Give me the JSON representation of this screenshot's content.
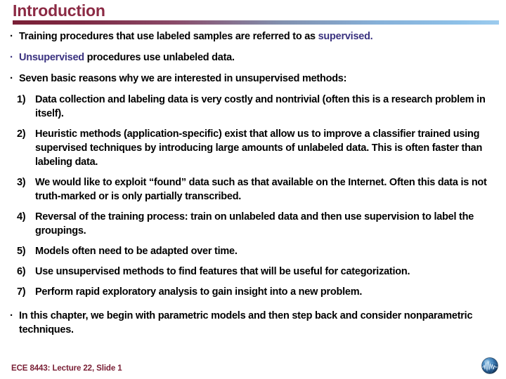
{
  "slide": {
    "title": "Introduction",
    "bullets": [
      {
        "marker": "·",
        "marker_accent": false,
        "segments": [
          {
            "text": "Training procedures that use labeled samples are referred to as ",
            "accent": false
          },
          {
            "text": "supervised.",
            "accent": true
          }
        ]
      },
      {
        "marker": "·",
        "marker_accent": true,
        "segments": [
          {
            "text": "Unsupervised",
            "accent": true
          },
          {
            "text": " procedures use unlabeled data.",
            "accent": false
          }
        ]
      },
      {
        "marker": "·",
        "marker_accent": false,
        "segments": [
          {
            "text": "Seven basic reasons why we are interested in unsupervised methods:",
            "accent": false
          }
        ]
      }
    ],
    "numbered_items": [
      {
        "marker": "1)",
        "text": "Data collection and labeling data is very costly and nontrivial (often this is a research problem in itself)."
      },
      {
        "marker": "2)",
        "text": "Heuristic methods (application-specific) exist that allow us to improve a classifier trained using supervised techniques by introducing large amounts of unlabeled data. This is often faster than labeling data."
      },
      {
        "marker": "3)",
        "text": "We would like to exploit “found” data such as that available on the Internet. Often this data is not truth-marked or is only partially transcribed."
      },
      {
        "marker": "4)",
        "text": "Reversal of the training process: train on unlabeled data and then use supervision to label the groupings."
      },
      {
        "marker": "5)",
        "text": "Models often need to be adapted over time."
      },
      {
        "marker": "6)",
        "text": "Use unsupervised methods to find features that will be useful for categorization."
      },
      {
        "marker": "7)",
        "text": "Perform rapid exploratory analysis to gain insight into a new problem."
      }
    ],
    "closing_bullet": {
      "marker": "·",
      "text": "In this chapter, we begin with parametric models and then step back and consider nonparametric techniques."
    },
    "footer": "ECE 8443: Lecture 22, Slide 1",
    "logo_name": "globe-waveform-logo",
    "colors": {
      "title": "#8B2A44",
      "accent_text": "#3B3380",
      "body_text": "#000000",
      "footer": "#7A2036",
      "rule_start": "#7A2036",
      "rule_end": "#9CCBEE",
      "background": "#FFFFFF"
    }
  }
}
